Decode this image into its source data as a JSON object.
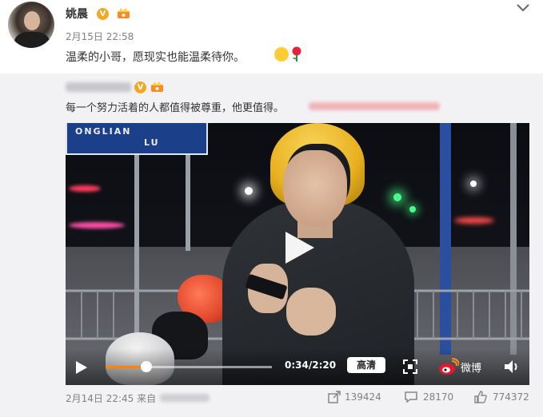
{
  "post": {
    "author": "姚晨",
    "verified_badge": "V",
    "time": "2月15日 22:58",
    "text": "温柔的小哥，愿现实也能温柔待你。"
  },
  "repost": {
    "text": "每一个努力活着的人都值得被尊重，他更值得。",
    "video": {
      "sign_line1": "ONGLIAN",
      "sign_line2": "LU",
      "time_display": "0:34/2:20",
      "quality_label": "高清",
      "brand_label": "微博",
      "progress": 0.243
    },
    "footer": {
      "time": "2月14日 22:45 来自",
      "share_count": "139424",
      "comment_count": "28170",
      "like_count": "774372"
    }
  }
}
